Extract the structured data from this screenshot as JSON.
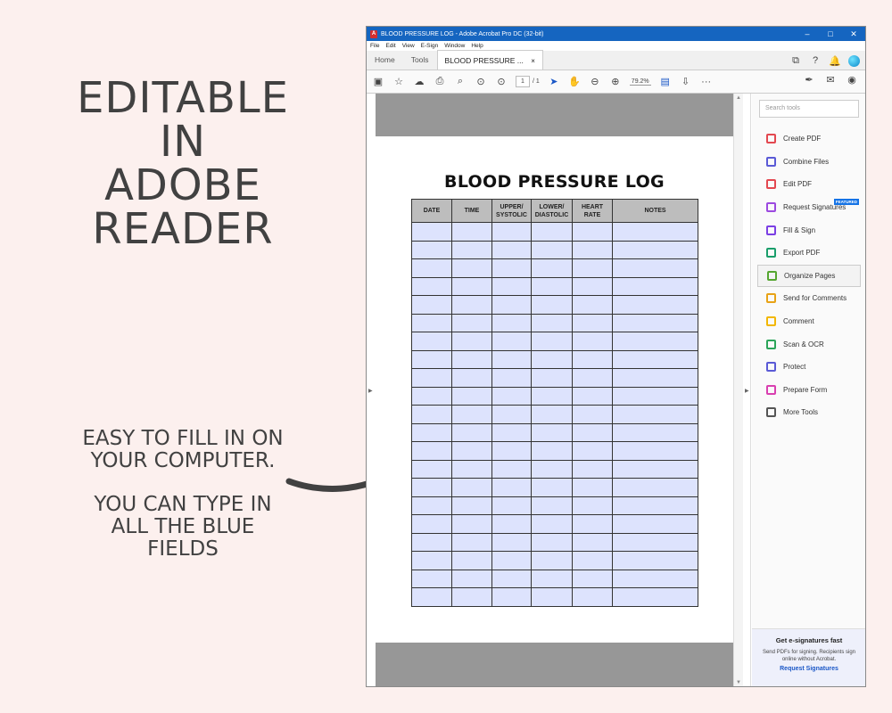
{
  "promo": {
    "headline": [
      "EDITABLE",
      "IN",
      "ADOBE",
      "READER"
    ],
    "sub1": [
      "EASY TO FILL IN ON",
      "YOUR COMPUTER."
    ],
    "sub2": [
      "YOU CAN TYPE IN",
      "ALL THE BLUE",
      "FIELDS"
    ]
  },
  "window": {
    "title": "BLOOD PRESSURE LOG - Adobe Acrobat Pro DC (32-bit)",
    "controls": [
      "–",
      "□",
      "✕"
    ],
    "menu": [
      "File",
      "Edit",
      "View",
      "E-Sign",
      "Window",
      "Help"
    ],
    "tabs": {
      "home": "Home",
      "tools": "Tools",
      "doc": "BLOOD PRESSURE ...",
      "close": "×"
    },
    "toolbar": {
      "page_current": "1",
      "page_total": "/ 1",
      "zoom": "79.2%",
      "more": "···"
    }
  },
  "document": {
    "title": "BLOOD PRESSURE LOG",
    "columns": [
      [
        "DATE"
      ],
      [
        "TIME"
      ],
      [
        "UPPER/",
        "SYSTOLIC"
      ],
      [
        "LOWER/",
        "DIASTOLIC"
      ],
      [
        "HEART",
        "RATE"
      ],
      [
        "NOTES"
      ]
    ],
    "row_count": 21,
    "field_color": "#dde3fd"
  },
  "tools_pane": {
    "search_placeholder": "Search tools",
    "tools": [
      {
        "label": "Create PDF",
        "icon": "create-pdf-icon",
        "color": "#e34850"
      },
      {
        "label": "Combine Files",
        "icon": "combine-files-icon",
        "color": "#5a5ad6"
      },
      {
        "label": "Edit PDF",
        "icon": "edit-pdf-icon",
        "color": "#e34850"
      },
      {
        "label": "Request Signatures",
        "icon": "request-signatures-icon",
        "color": "#9c4ae0",
        "badge": "FEATURED"
      },
      {
        "label": "Fill & Sign",
        "icon": "fill-sign-icon",
        "color": "#7b3fe4"
      },
      {
        "label": "Export PDF",
        "icon": "export-pdf-icon",
        "color": "#1a9e6b"
      },
      {
        "label": "Organize Pages",
        "icon": "organize-pages-icon",
        "color": "#55a630",
        "active": true
      },
      {
        "label": "Send for Comments",
        "icon": "send-comments-icon",
        "color": "#e8a317"
      },
      {
        "label": "Comment",
        "icon": "comment-icon",
        "color": "#f2b705"
      },
      {
        "label": "Scan & OCR",
        "icon": "scan-ocr-icon",
        "color": "#2ca55a"
      },
      {
        "label": "Protect",
        "icon": "protect-icon",
        "color": "#5a5ad6"
      },
      {
        "label": "Prepare Form",
        "icon": "prepare-form-icon",
        "color": "#d93fb0"
      },
      {
        "label": "More Tools",
        "icon": "more-tools-icon",
        "color": "#555555"
      }
    ],
    "promo": {
      "title": "Get e-signatures fast",
      "desc": "Send PDFs for signing. Recipients sign online without Acrobat.",
      "link": "Request Signatures"
    }
  }
}
